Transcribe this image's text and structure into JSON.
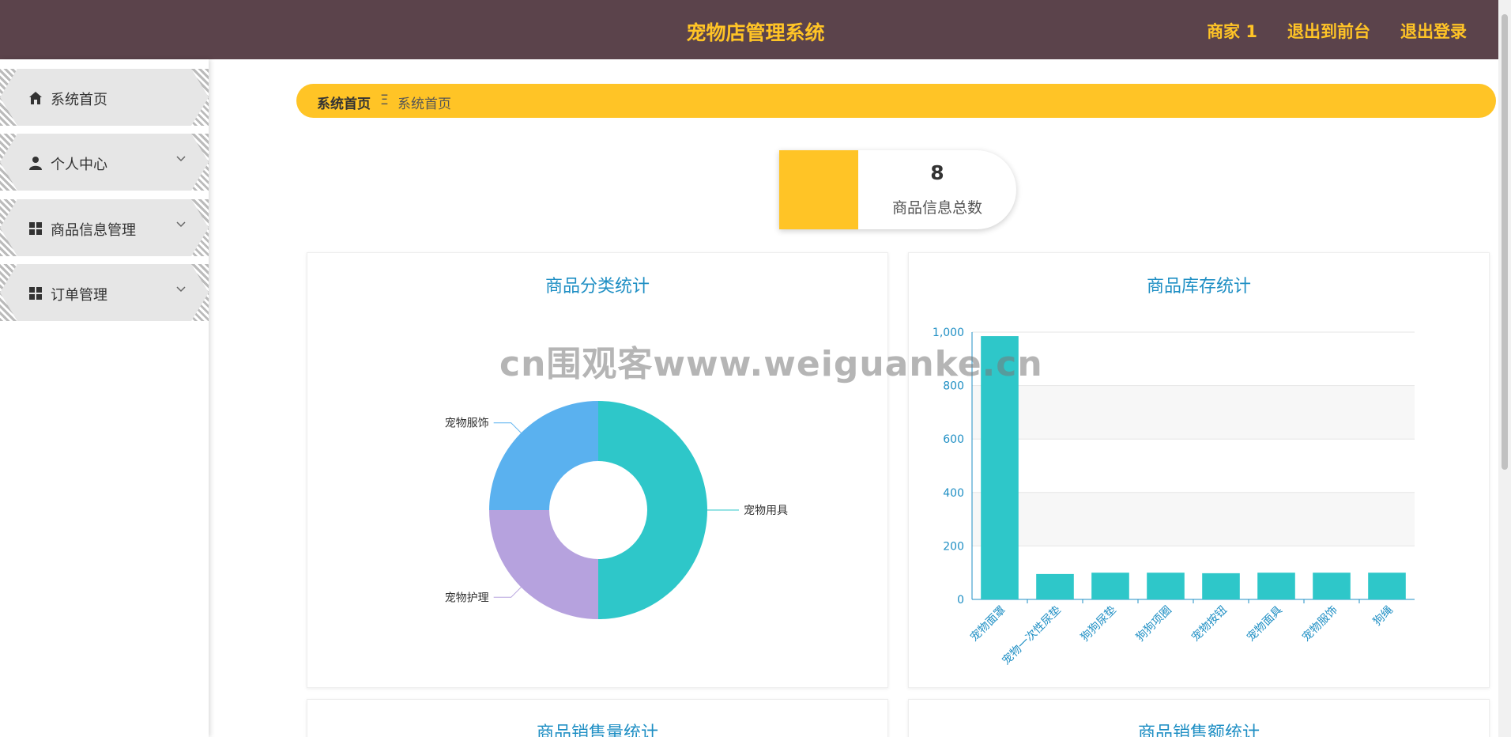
{
  "header": {
    "title": "宠物店管理系统",
    "links": [
      "商家 1",
      "退出到前台",
      "退出登录"
    ]
  },
  "sidebar": {
    "items": [
      {
        "label": "系统首页",
        "icon": "home-icon",
        "has_submenu": false
      },
      {
        "label": "个人中心",
        "icon": "user-icon",
        "has_submenu": true
      },
      {
        "label": "商品信息管理",
        "icon": "grid-icon",
        "has_submenu": true
      },
      {
        "label": "订单管理",
        "icon": "grid-icon",
        "has_submenu": true
      }
    ]
  },
  "breadcrumb": {
    "home": "系统首页",
    "separator": "Ξ",
    "current": "系统首页"
  },
  "stat": {
    "value": "8",
    "label": "商品信息总数"
  },
  "watermark": "cn围观客www.weiguanke.cn",
  "colors": {
    "header": "#5b434b",
    "accent": "#ffc426",
    "title_blue": "#1f8fc4",
    "bar": "#2ec7c9"
  },
  "panels": {
    "category_title": "商品分类统计",
    "stock_title": "商品库存统计",
    "sales_qty_title": "商品销售量统计",
    "sales_amount_title": "商品销售额统计"
  },
  "chart_data": [
    {
      "type": "pie",
      "title": "商品分类统计",
      "donut": true,
      "slices": [
        {
          "name": "宠物用具",
          "value": 50,
          "color": "#2ec7c9"
        },
        {
          "name": "宠物护理",
          "value": 25,
          "color": "#b6a2de"
        },
        {
          "name": "宠物服饰",
          "value": 25,
          "color": "#5ab1ef"
        }
      ]
    },
    {
      "type": "bar",
      "title": "商品库存统计",
      "categories": [
        "宠物面罩",
        "宠物一次性尿垫",
        "狗狗尿垫",
        "狗狗项圈",
        "宠物按钮",
        "宠物面具",
        "宠物服饰",
        "狗绳"
      ],
      "values": [
        985,
        95,
        100,
        100,
        98,
        100,
        100,
        100
      ],
      "ylim": [
        0,
        1000
      ],
      "yticks": [
        0,
        200,
        400,
        600,
        800,
        1000
      ],
      "ytick_labels": [
        "0",
        "200",
        "400",
        "600",
        "800",
        "1,000"
      ],
      "grid": true
    }
  ]
}
